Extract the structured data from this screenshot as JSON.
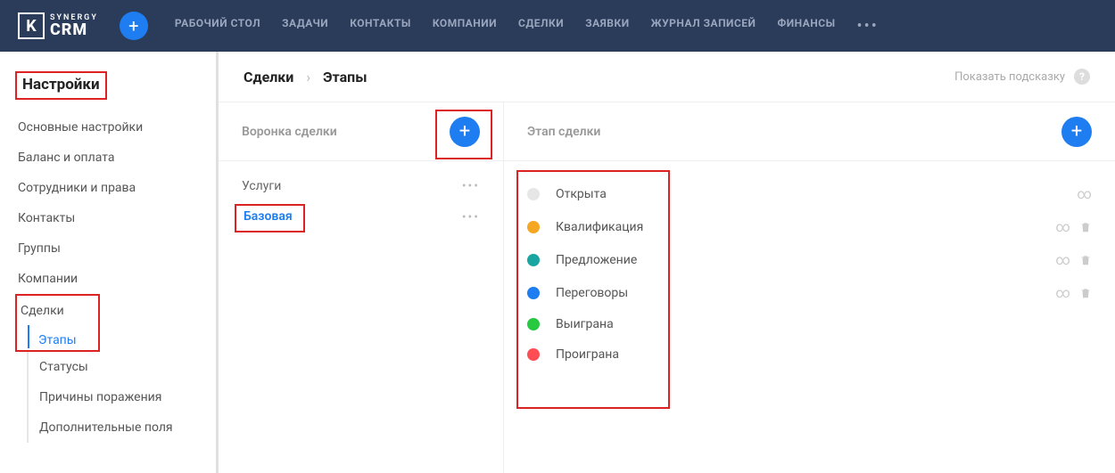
{
  "brand": {
    "line1": "SYNERGY",
    "line2": "CRM",
    "mark": "K"
  },
  "nav": {
    "items": [
      "РАБОЧИЙ СТОЛ",
      "ЗАДАЧИ",
      "КОНТАКТЫ",
      "КОМПАНИИ",
      "СДЕЛКИ",
      "ЗАЯВКИ",
      "ЖУРНАЛ ЗАПИСЕЙ",
      "ФИНАНСЫ"
    ],
    "more": "•••"
  },
  "sidebar": {
    "title": "Настройки",
    "items": [
      "Основные настройки",
      "Баланс и оплата",
      "Сотрудники и права",
      "Контакты",
      "Группы",
      "Компании"
    ],
    "deals_group": {
      "label": "Сделки",
      "sub": [
        {
          "label": "Этапы",
          "active": true
        },
        {
          "label": "Статусы"
        },
        {
          "label": "Причины поражения"
        },
        {
          "label": "Дополнительные поля"
        }
      ]
    }
  },
  "breadcrumb": {
    "root": "Сделки",
    "leaf": "Этапы"
  },
  "hint": {
    "label": "Показать подсказку",
    "mark": "?"
  },
  "funnels": {
    "title": "Воронка сделки",
    "items": [
      {
        "name": "Услуги",
        "active": false
      },
      {
        "name": "Базовая",
        "active": true
      }
    ]
  },
  "stages": {
    "title": "Этап сделки",
    "items": [
      {
        "name": "Открыта",
        "color": "#e6e6e6",
        "infinite": true,
        "deletable": false
      },
      {
        "name": "Квалификация",
        "color": "#f5a623",
        "infinite": true,
        "deletable": true
      },
      {
        "name": "Предложение",
        "color": "#1aa6a0",
        "infinite": true,
        "deletable": true
      },
      {
        "name": "Переговоры",
        "color": "#1e7df0",
        "infinite": true,
        "deletable": true
      },
      {
        "name": "Выиграна",
        "color": "#26c940",
        "infinite": false,
        "deletable": false
      },
      {
        "name": "Проиграна",
        "color": "#ff4d55",
        "infinite": false,
        "deletable": false
      }
    ]
  },
  "glyph": {
    "more": "•••",
    "infinity": "∞",
    "plus": "+",
    "chevron": "›"
  }
}
